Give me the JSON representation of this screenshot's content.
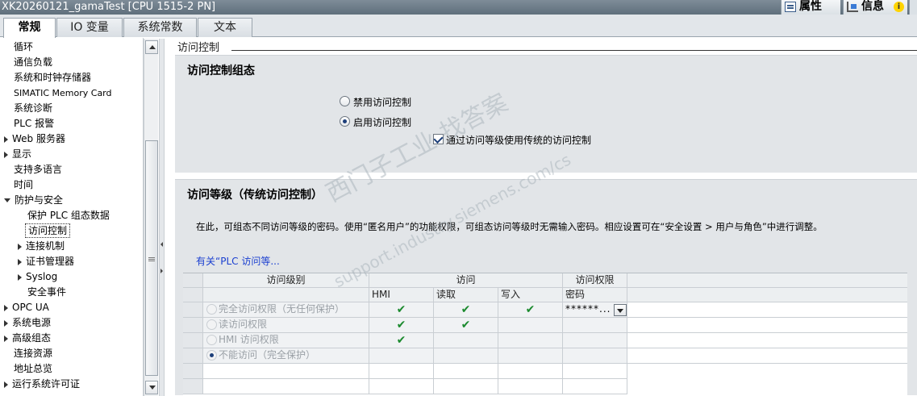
{
  "window": {
    "title": "XK20260121_gamaTest [CPU 1515-2 PN]"
  },
  "inspector_tabs": {
    "properties": "属性",
    "info": "信息",
    "info_badge": "i"
  },
  "tabs": [
    {
      "label": "常规",
      "active": true
    },
    {
      "label": "IO 变量"
    },
    {
      "label": "系统常数"
    },
    {
      "label": "文本"
    }
  ],
  "tree": {
    "items": [
      {
        "label": "循环"
      },
      {
        "label": "通信负载"
      },
      {
        "label": "系统和时钟存储器"
      },
      {
        "label": "SIMATIC Memory Card"
      },
      {
        "label": "系统诊断"
      },
      {
        "label": "PLC 报警"
      },
      {
        "label": "Web 服务器"
      },
      {
        "label": "显示"
      },
      {
        "label": "支持多语言"
      },
      {
        "label": "时间"
      },
      {
        "label": "防护与安全"
      },
      {
        "label": "保护 PLC 组态数据"
      },
      {
        "label": "访问控制"
      },
      {
        "label": "连接机制"
      },
      {
        "label": "证书管理器"
      },
      {
        "label": "Syslog"
      },
      {
        "label": "安全事件"
      },
      {
        "label": "OPC UA"
      },
      {
        "label": "系统电源"
      },
      {
        "label": "高级组态"
      },
      {
        "label": "连接资源"
      },
      {
        "label": "地址总览"
      },
      {
        "label": "运行系统许可证"
      }
    ]
  },
  "main": {
    "section_title": "访问控制",
    "config_group": {
      "title": "访问控制组态",
      "radio_disable": "禁用访问控制",
      "radio_enable": "启用访问控制",
      "checkbox_legacy": "通过访问等级使用传统的访问控制"
    },
    "levels_group": {
      "title": "访问等级（传统访问控制）",
      "description": "在此，可组态不同访问等级的密码。使用“匿名用户”的功能权限，可组态访问等级时无需输入密码。相应设置可在“安全设置 > 用户与角色”中进行调整。",
      "link": "有关“PLC 访问等..."
    },
    "table": {
      "headers": {
        "level": "访问级别",
        "access": "访问",
        "rights": "访问权限"
      },
      "subheaders": {
        "hmi": "HMI",
        "read": "读取",
        "write": "写入",
        "password": "密码"
      },
      "rows": [
        {
          "level": "完全访问权限（无任何保护）",
          "hmi": "✔",
          "read": "✔",
          "write": "✔",
          "password": "******..."
        },
        {
          "level": "读访问权限",
          "hmi": "✔",
          "read": "✔",
          "write": "",
          "password": ""
        },
        {
          "level": "HMI 访问权限",
          "hmi": "✔",
          "read": "",
          "write": "",
          "password": ""
        },
        {
          "level": "不能访问（完全保护）",
          "hmi": "",
          "read": "",
          "write": "",
          "password": ""
        }
      ]
    },
    "watermark": {
      "line1": "西门子工业 找答案",
      "line2": "support.industry.siemens.com/cs"
    }
  }
}
